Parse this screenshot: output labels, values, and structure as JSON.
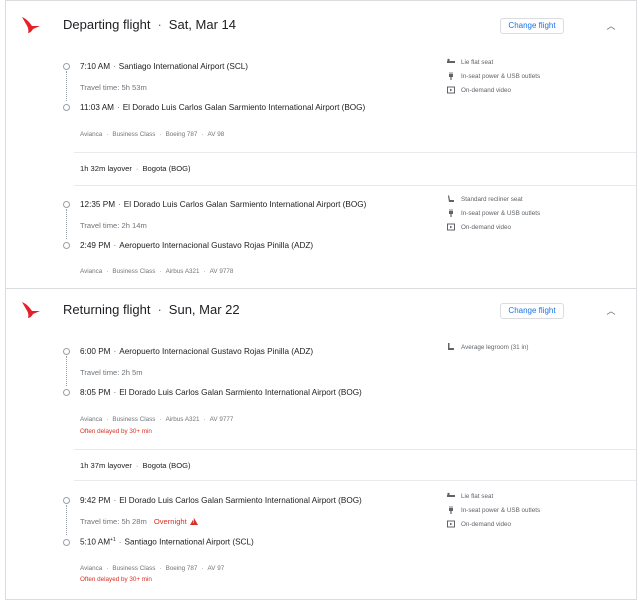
{
  "departing": {
    "title": "Departing flight",
    "date": "Sat, Mar 14",
    "change_label": "Change flight",
    "seg1": {
      "dep_time": "7:10 AM",
      "dep_airport": "Santiago International Airport (SCL)",
      "travel": "Travel time: 5h 53m",
      "arr_time": "11:03 AM",
      "arr_airport": "El Dorado Luis Carlos Galan Sarmiento International Airport (BOG)",
      "airline": "Avianca",
      "cabin": "Business Class",
      "aircraft": "Boeing 787",
      "flight": "AV 98",
      "amenities": [
        "Lie flat seat",
        "In-seat power & USB outlets",
        "On-demand video"
      ]
    },
    "layover": {
      "duration": "1h 32m layover",
      "city": "Bogota (BOG)"
    },
    "seg2": {
      "dep_time": "12:35 PM",
      "dep_airport": "El Dorado Luis Carlos Galan Sarmiento International Airport (BOG)",
      "travel": "Travel time: 2h 14m",
      "arr_time": "2:49 PM",
      "arr_airport": "Aeropuerto Internacional Gustavo Rojas Pinilla (ADZ)",
      "airline": "Avianca",
      "cabin": "Business Class",
      "aircraft": "Airbus A321",
      "flight": "AV 9778",
      "amenities": [
        "Standard recliner seat",
        "In-seat power & USB outlets",
        "On-demand video"
      ]
    }
  },
  "returning": {
    "title": "Returning flight",
    "date": "Sun, Mar 22",
    "change_label": "Change flight",
    "seg1": {
      "dep_time": "6:00 PM",
      "dep_airport": "Aeropuerto Internacional Gustavo Rojas Pinilla (ADZ)",
      "travel": "Travel time: 2h 5m",
      "arr_time": "8:05 PM",
      "arr_airport": "El Dorado Luis Carlos Galan Sarmiento International Airport (BOG)",
      "airline": "Avianca",
      "cabin": "Business Class",
      "aircraft": "Airbus A321",
      "flight": "AV 9777",
      "delay": "Often delayed by 30+ min",
      "amenities": [
        "Average legroom (31 in)"
      ]
    },
    "layover": {
      "duration": "1h 37m layover",
      "city": "Bogota (BOG)"
    },
    "seg2": {
      "dep_time": "9:42 PM",
      "dep_airport": "El Dorado Luis Carlos Galan Sarmiento International Airport (BOG)",
      "travel": "Travel time: 5h 28m",
      "overnight": "Overnight",
      "arr_time": "5:10 AM",
      "arr_sup": "+1",
      "arr_airport": "Santiago International Airport (SCL)",
      "airline": "Avianca",
      "cabin": "Business Class",
      "aircraft": "Boeing 787",
      "flight": "AV 97",
      "delay": "Often delayed by 30+ min",
      "amenities": [
        "Lie flat seat",
        "In-seat power & USB outlets",
        "On-demand video"
      ]
    }
  },
  "colors": {
    "accent": "#1a73e8",
    "warning": "#d93025",
    "logo": "#e4202b"
  },
  "icons": {
    "logo": "avianca-logo",
    "collapse": "chevron-up-icon"
  }
}
